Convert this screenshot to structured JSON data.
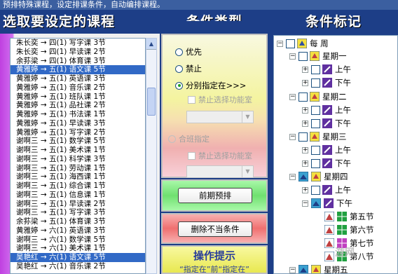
{
  "banner": {
    "text": "预排特殊课程，设定排课条件，自动编排课程。"
  },
  "headers": {
    "left": "选取要设定的课程",
    "middle": "条件类型",
    "right": "条件标记"
  },
  "course_list": {
    "items": [
      "朱长奕 → 四(1) 写字课 3节",
      "朱长奕 → 四(1) 早读课 2节",
      "余荪梁 → 四(1) 体育课 3节",
      "黄雅婷 → 五(1) 语文课 5节",
      "黄雅婷 → 五(1) 英语课 3节",
      "黄雅婷 → 五(1) 音乐课 2节",
      "黄雅婷 → 五(1) 班队课 1节",
      "黄雅婷 → 五(1) 品社课 2节",
      "黄雅婷 → 五(1) 书法课 1节",
      "黄雅婷 → 五(1) 早读课 3节",
      "黄雅婷 → 五(1) 写字课 2节",
      "谢啊三 → 五(1) 数学课 5节",
      "谢啊三 → 五(1) 美术课 1节",
      "谢啊三 → 五(1) 科学课 3节",
      "谢啊三 → 五(1) 劳动课 1节",
      "谢啊三 → 五(1) 海西课 1节",
      "谢啊三 → 五(1) 综合课 1节",
      "谢啊三 → 五(1) 信息课 1节",
      "谢啊三 → 五(1) 早读课 2节",
      "谢啊三 → 五(1) 写字课 3节",
      "余荪梁 → 五(1) 体育课 3节",
      "黄雅婷 → 六(1) 英语课 3节",
      "谢啊三 → 六(1) 数学课 5节",
      "谢啊三 → 六(1) 美术课 1节",
      "吴艳红 → 六(1) 语文课 5节",
      "吴艳红 → 六(1) 音乐课 2节"
    ],
    "selected_indices": [
      3,
      24
    ]
  },
  "conditions": {
    "radio_priority": "优先",
    "radio_forbid": "禁止",
    "radio_specify": "分别指定在>>>",
    "check_forbid_room_1": "禁止选择功能室",
    "merge_label": "合班指定",
    "check_forbid_room_2": "禁止选择功能室",
    "btn_pre_schedule": "前期预排",
    "btn_delete": "删除不当条件",
    "tip_title": "操作提示",
    "tip_text": "“指定在”前“指定在”"
  },
  "tree": {
    "root": "每 周",
    "days": [
      "星期一",
      "星期二",
      "星期三",
      "星期四",
      "星期五"
    ],
    "am": "上午",
    "pm": "下午",
    "periods": [
      "第五节",
      "第六节",
      "第七节",
      "第八节"
    ]
  },
  "watermark": "游网"
}
